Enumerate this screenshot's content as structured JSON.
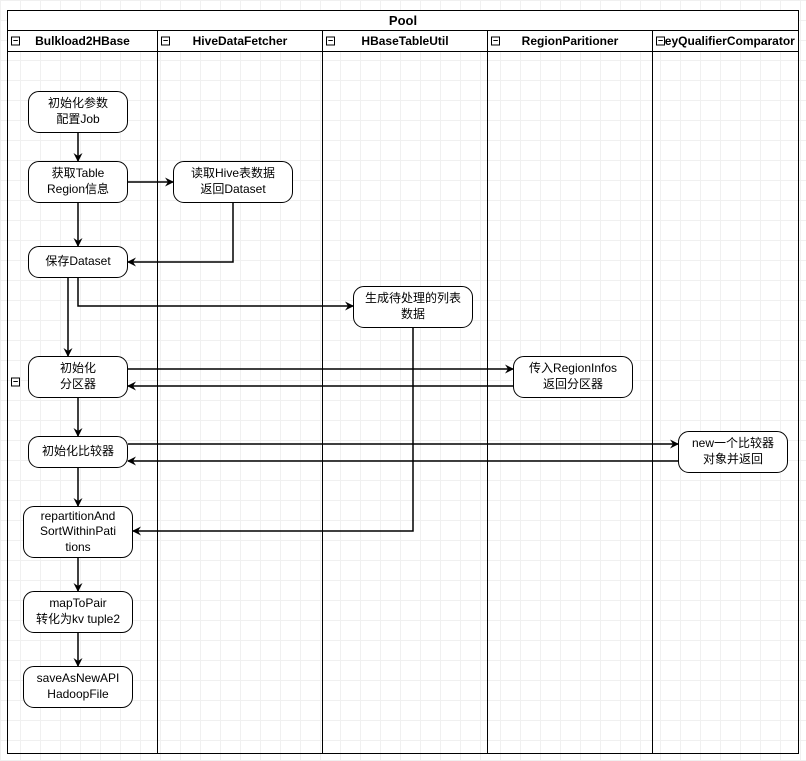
{
  "diagram_type": "swimlane",
  "pool": {
    "title": "Pool"
  },
  "lanes": [
    {
      "id": "lane1",
      "title": "Bulkload2HBase"
    },
    {
      "id": "lane2",
      "title": "HiveDataFetcher"
    },
    {
      "id": "lane3",
      "title": "HBaseTableUtil"
    },
    {
      "id": "lane4",
      "title": "RegionParitioner"
    },
    {
      "id": "lane5",
      "title": "KeyQualifierComparator"
    }
  ],
  "nodes": {
    "n1": {
      "lane": 1,
      "label": "初始化参数\n配置Job"
    },
    "n2": {
      "lane": 1,
      "label": "获取Table\nRegion信息"
    },
    "n3": {
      "lane": 2,
      "label": "读取Hive表数据\n返回Dataset"
    },
    "n4": {
      "lane": 1,
      "label": "保存Dataset"
    },
    "n5": {
      "lane": 3,
      "label": "生成待处理的列表\n数据"
    },
    "n6": {
      "lane": 1,
      "label": "初始化\n分区器"
    },
    "n7": {
      "lane": 4,
      "label": "传入RegionInfos\n返回分区器"
    },
    "n8": {
      "lane": 1,
      "label": "初始化比较器"
    },
    "n9": {
      "lane": 5,
      "label": "new一个比较器\n对象并返回"
    },
    "n10": {
      "lane": 1,
      "label": "repartitionAnd\nSortWithinPati\ntions"
    },
    "n11": {
      "lane": 1,
      "label": "mapToPair\n转化为kv tuple2"
    },
    "n12": {
      "lane": 1,
      "label": "saveAsNewAPI\nHadoopFile"
    }
  },
  "edges": [
    {
      "from": "n1",
      "to": "n2"
    },
    {
      "from": "n2",
      "to": "n3"
    },
    {
      "from": "n2",
      "to": "n4"
    },
    {
      "from": "n3",
      "to": "n4"
    },
    {
      "from": "n4",
      "to": "n5"
    },
    {
      "from": "n6",
      "to": "n7"
    },
    {
      "from": "n7",
      "to": "n6"
    },
    {
      "from": "n4",
      "to": "n6"
    },
    {
      "from": "n6",
      "to": "n8"
    },
    {
      "from": "n8",
      "to": "n9"
    },
    {
      "from": "n9",
      "to": "n8"
    },
    {
      "from": "n5",
      "to": "n10"
    },
    {
      "from": "n8",
      "to": "n10"
    },
    {
      "from": "n10",
      "to": "n11"
    },
    {
      "from": "n11",
      "to": "n12"
    }
  ]
}
